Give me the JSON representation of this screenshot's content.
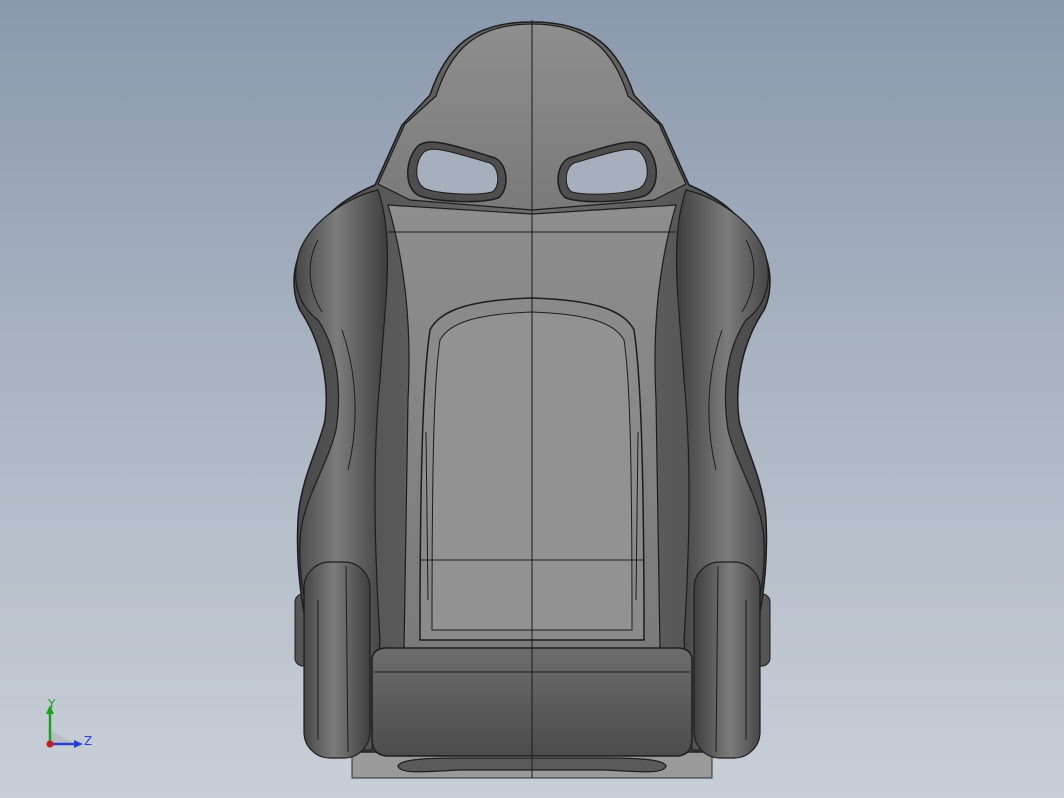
{
  "viewport": {
    "background_top": "#8b99ad",
    "background_bottom": "#c9cfd7"
  },
  "model": {
    "shell_color": "#5e5e5e",
    "cushion_color": "#878787",
    "edge_color": "#1c1c1c"
  },
  "triad": {
    "y_label": "Y",
    "z_label": "Z",
    "y_color": "#1aa31a",
    "z_color": "#2a3fcf",
    "x_color": "#c41a1a"
  }
}
